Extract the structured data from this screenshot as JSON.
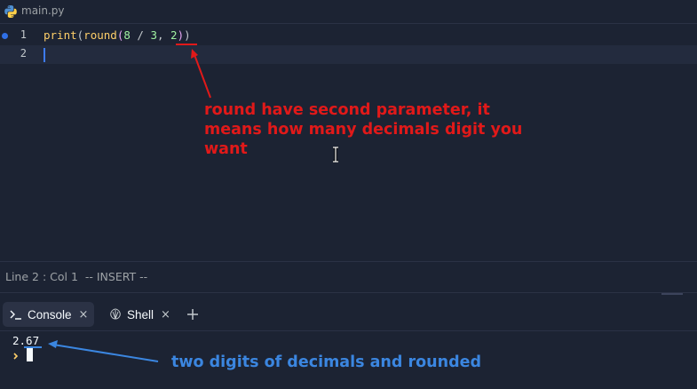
{
  "editor_tab": {
    "title": "main.py",
    "icon": "python-icon"
  },
  "code": {
    "line1": {
      "number": "1",
      "tokens": [
        "print",
        "(",
        "round",
        "(",
        "8",
        " / ",
        "3",
        ", ",
        "2",
        ")",
        ")"
      ]
    },
    "line2": {
      "number": "2"
    }
  },
  "annotations": {
    "red_note": "round have second parameter, it means how many decimals digit you want",
    "blue_note": "two digits of decimals and rounded",
    "red_color": "#e11919",
    "blue_color": "#3b86e0"
  },
  "status_bar": {
    "text": "Line 2 : Col 1  -- INSERT --"
  },
  "pane_tabs": [
    {
      "label": "Console",
      "icon": "terminal-icon",
      "close": "×"
    },
    {
      "label": "Shell",
      "icon": "shell-icon",
      "close": "×"
    }
  ],
  "console": {
    "output": "2.67"
  }
}
